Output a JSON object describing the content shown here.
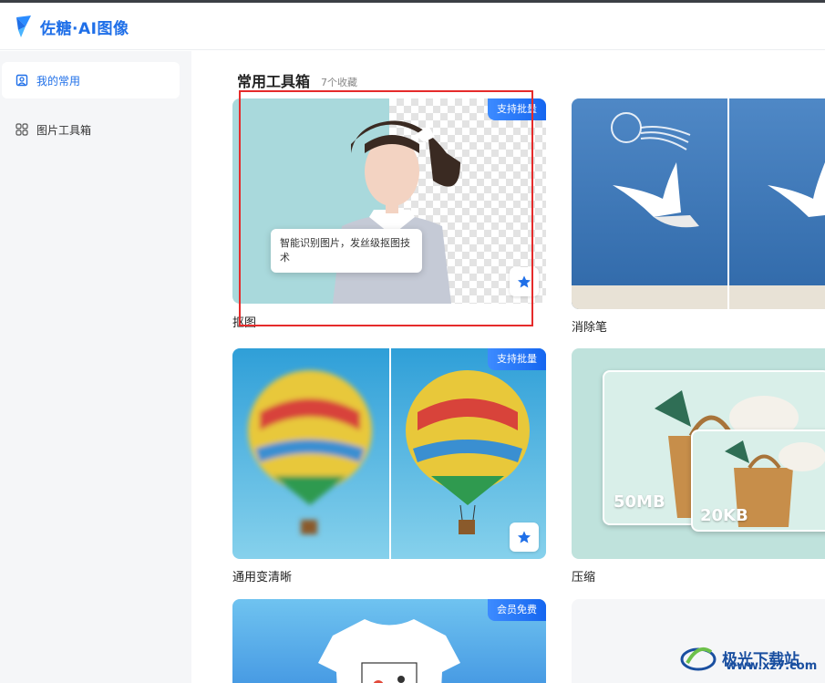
{
  "app": {
    "logo_text": "佐糖·AI图像"
  },
  "sidebar": {
    "items": [
      {
        "label": "我的常用",
        "icon": "favorites-icon",
        "active": true
      },
      {
        "label": "图片工具箱",
        "icon": "grid-icon",
        "active": false
      }
    ]
  },
  "main": {
    "section_title": "常用工具箱",
    "section_count": "7个收藏",
    "cards": [
      {
        "label": "抠图",
        "badge": "支持批量",
        "tooltip": "智能识别图片，发丝级抠图技术"
      },
      {
        "label": "消除笔"
      },
      {
        "label": "通用变清晰",
        "badge": "支持批量"
      },
      {
        "label": "压缩",
        "size_before": "50MB",
        "size_after": "20KB"
      },
      {
        "label": "",
        "badge": "会员免费"
      }
    ]
  },
  "watermark": {
    "text": "极光下载站",
    "url": "www.xz7.com"
  },
  "colors": {
    "accent": "#1f6fe8",
    "highlight_box": "#e52b2b"
  }
}
